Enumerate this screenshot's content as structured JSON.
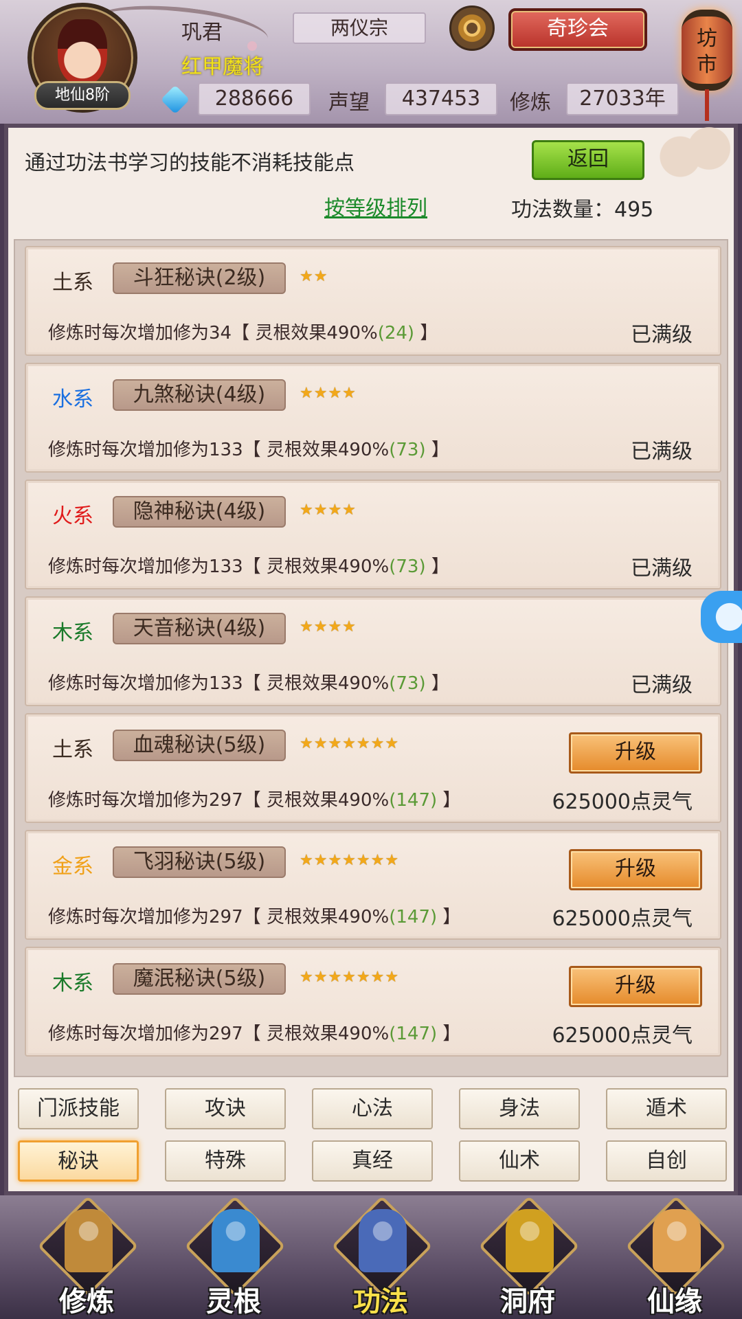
{
  "header": {
    "player_name": "巩君",
    "player_title": "红甲魔将",
    "rank": "地仙8阶",
    "sect": "两仪宗",
    "treasure_button": "奇珍会",
    "market_label": "坊市",
    "spirit_stones": "288666",
    "reputation_label": "声望",
    "reputation": "437453",
    "cultivation_label": "修炼",
    "cultivation": "27033年"
  },
  "panel": {
    "hint": "通过功法书学习的技能不消耗技能点",
    "back_button": "返回",
    "sort_link": "按等级排列",
    "count_label": "功法数量：495"
  },
  "skills": [
    {
      "element": "土系",
      "element_color": "#3a2a20",
      "name": "斗狂秘诀(2级)",
      "stars": "★★",
      "desc_prefix": "修炼时每次增加修为34【 灵根效果490%",
      "desc_value": "(24)",
      "desc_suffix": " 】",
      "status": "已满级"
    },
    {
      "element": "水系",
      "element_color": "#1a6fe0",
      "name": "九煞秘诀(4级)",
      "stars": "★★★★",
      "desc_prefix": "修炼时每次增加修为133【 灵根效果490%",
      "desc_value": "(73)",
      "desc_suffix": " 】",
      "status": "已满级"
    },
    {
      "element": "火系",
      "element_color": "#e01a1a",
      "name": "隐神秘诀(4级)",
      "stars": "★★★★",
      "desc_prefix": "修炼时每次增加修为133【 灵根效果490%",
      "desc_value": "(73)",
      "desc_suffix": " 】",
      "status": "已满级"
    },
    {
      "element": "木系",
      "element_color": "#1a7a2a",
      "name": "天音秘诀(4级)",
      "stars": "★★★★",
      "desc_prefix": "修炼时每次增加修为133【 灵根效果490%",
      "desc_value": "(73)",
      "desc_suffix": " 】",
      "status": "已满级"
    },
    {
      "element": "土系",
      "element_color": "#3a2a20",
      "name": "血魂秘诀(5级)",
      "stars": "★★★★★★★",
      "desc_prefix": "修炼时每次增加修为297【 灵根效果490%",
      "desc_value": "(147)",
      "desc_suffix": " 】",
      "upgrade": "升级",
      "cost": "625000点灵气"
    },
    {
      "element": "金系",
      "element_color": "#f0a018",
      "name": "飞羽秘诀(5级)",
      "stars": "★★★★★★★",
      "desc_prefix": "修炼时每次增加修为297【 灵根效果490%",
      "desc_value": "(147)",
      "desc_suffix": " 】",
      "upgrade": "升级",
      "cost": "625000点灵气"
    },
    {
      "element": "木系",
      "element_color": "#1a7a2a",
      "name": "魔泯秘诀(5级)",
      "stars": "★★★★★★★",
      "desc_prefix": "修炼时每次增加修为297【 灵根效果490%",
      "desc_value": "(147)",
      "desc_suffix": " 】",
      "upgrade": "升级",
      "cost": "625000点灵气"
    }
  ],
  "tabs": [
    {
      "label": "门派技能",
      "active": false
    },
    {
      "label": "攻诀",
      "active": false
    },
    {
      "label": "心法",
      "active": false
    },
    {
      "label": "身法",
      "active": false
    },
    {
      "label": "遁术",
      "active": false
    },
    {
      "label": "秘诀",
      "active": true
    },
    {
      "label": "特殊",
      "active": false
    },
    {
      "label": "真经",
      "active": false
    },
    {
      "label": "仙术",
      "active": false
    },
    {
      "label": "自创",
      "active": false
    }
  ],
  "bottom_nav": [
    {
      "label": "修炼",
      "icon": "monk-icon",
      "active": false
    },
    {
      "label": "灵根",
      "icon": "yinyang-sword-icon",
      "active": false
    },
    {
      "label": "功法",
      "icon": "book-icon",
      "active": true
    },
    {
      "label": "洞府",
      "icon": "pavilion-icon",
      "active": false
    },
    {
      "label": "仙缘",
      "icon": "gourd-icon",
      "active": false
    }
  ],
  "colors": {
    "accent_orange": "#e58a2a",
    "back_green": "#5fae18",
    "link_green": "#1b8a2a",
    "value_green": "#5a9a36",
    "panel_frame": "#5a4a5e"
  }
}
